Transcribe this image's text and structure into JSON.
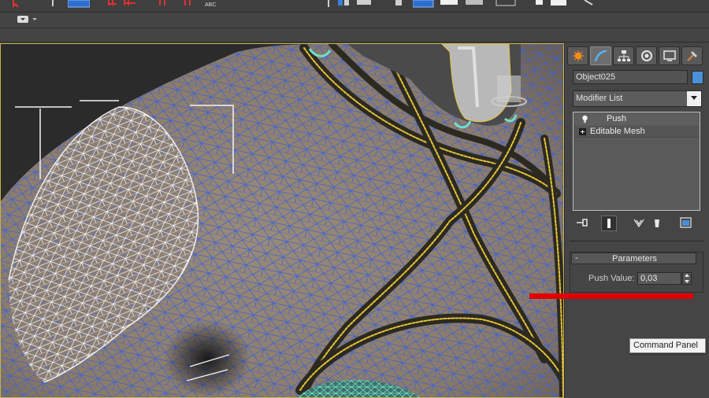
{
  "toolbar": {
    "text_label": "ABC"
  },
  "command_panel": {
    "tooltip": "Command Panel",
    "object_name": "Object025",
    "object_color": "#4a8fd8",
    "modifier_list_label": "Modifier List",
    "stack": [
      {
        "label": "Push"
      },
      {
        "label": "Editable Mesh"
      }
    ],
    "rollout": {
      "toggle": "-",
      "title": "Parameters",
      "push_value_label": "Push Value:",
      "push_value": "0,03"
    }
  },
  "colors": {
    "viewport_border": "#c8b24a",
    "wire_blue": "#3a62d8",
    "wire_white": "#f4f4f4",
    "strap_yellow": "#e6c53a",
    "annotation_red": "#e00000",
    "accent_cyan": "#6fe0c8"
  }
}
